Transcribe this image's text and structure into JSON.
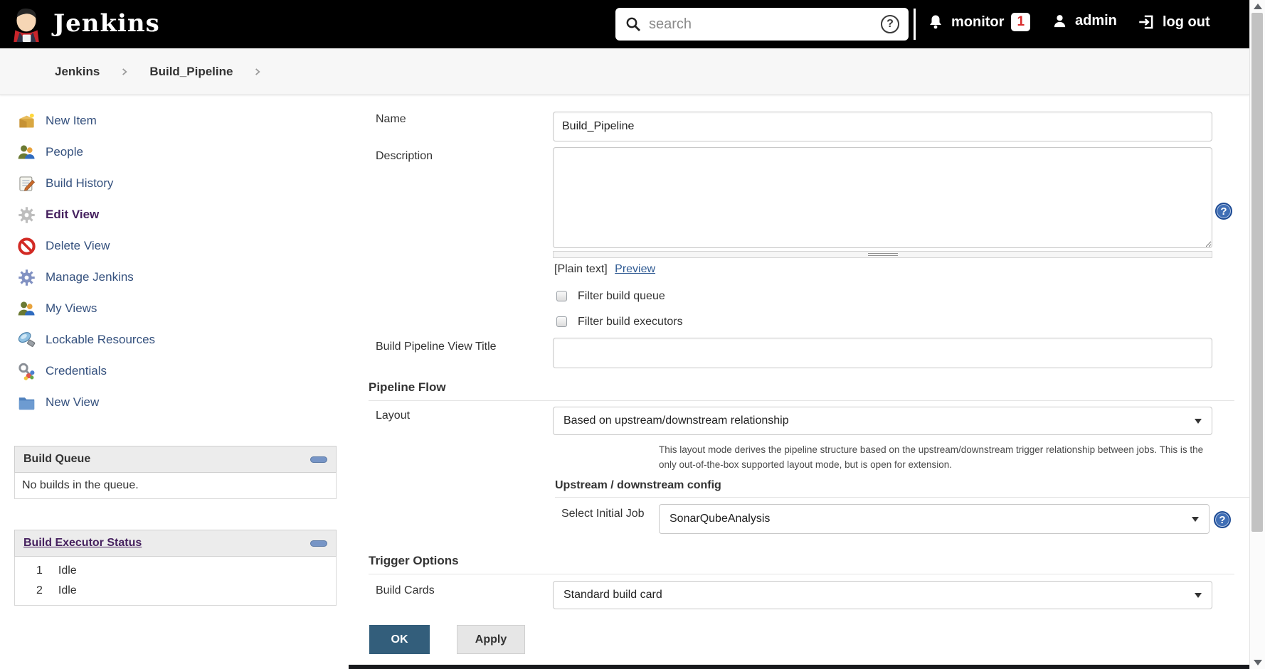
{
  "header": {
    "brand": "Jenkins",
    "search_placeholder": "search",
    "monitor_label": "monitor",
    "monitor_badge": "1",
    "user_label": "admin",
    "logout_label": "log out"
  },
  "breadcrumb": {
    "items": [
      "Jenkins",
      "Build_Pipeline"
    ]
  },
  "sidebar": {
    "items": [
      {
        "label": "New Item",
        "icon": "new-item-icon"
      },
      {
        "label": "People",
        "icon": "people-icon"
      },
      {
        "label": "Build History",
        "icon": "build-history-icon"
      },
      {
        "label": "Edit View",
        "icon": "edit-view-icon",
        "active": true
      },
      {
        "label": "Delete View",
        "icon": "delete-view-icon"
      },
      {
        "label": "Manage Jenkins",
        "icon": "manage-jenkins-icon"
      },
      {
        "label": "My Views",
        "icon": "my-views-icon"
      },
      {
        "label": "Lockable Resources",
        "icon": "lockable-resources-icon"
      },
      {
        "label": "Credentials",
        "icon": "credentials-icon"
      },
      {
        "label": "New View",
        "icon": "new-view-icon"
      }
    ],
    "build_queue": {
      "title": "Build Queue",
      "empty_text": "No builds in the queue."
    },
    "executor_status": {
      "title": "Build Executor Status",
      "rows": [
        {
          "num": "1",
          "state": "Idle"
        },
        {
          "num": "2",
          "state": "Idle"
        }
      ]
    }
  },
  "form": {
    "name_label": "Name",
    "name_value": "Build_Pipeline",
    "description_label": "Description",
    "description_value": "",
    "markup_hint": "[Plain text]",
    "preview_label": "Preview",
    "filter_queue_label": "Filter build queue",
    "filter_executors_label": "Filter build executors",
    "view_title_label": "Build Pipeline View Title",
    "view_title_value": "",
    "pipeline_flow_heading": "Pipeline Flow",
    "layout_label": "Layout",
    "layout_value": "Based on upstream/downstream relationship",
    "layout_help": "This layout mode derives the pipeline structure based on the upstream/downstream trigger relationship between jobs. This is the only out-of-the-box supported layout mode, but is open for extension.",
    "upstream_heading": "Upstream / downstream config",
    "initial_job_label": "Select Initial Job",
    "initial_job_value": "SonarQubeAnalysis",
    "trigger_heading": "Trigger Options",
    "build_cards_label": "Build Cards",
    "build_cards_value": "Standard build card",
    "ok_label": "OK",
    "apply_label": "Apply"
  },
  "colors": {
    "header_bg": "#000000",
    "link_blue": "#2f5a93",
    "sidebar_link": "#35517e",
    "visited_purple": "#46215f",
    "badge_red": "#d82c2c",
    "ok_button": "#335e7b",
    "help_icon_blue": "#3f6eb5"
  }
}
